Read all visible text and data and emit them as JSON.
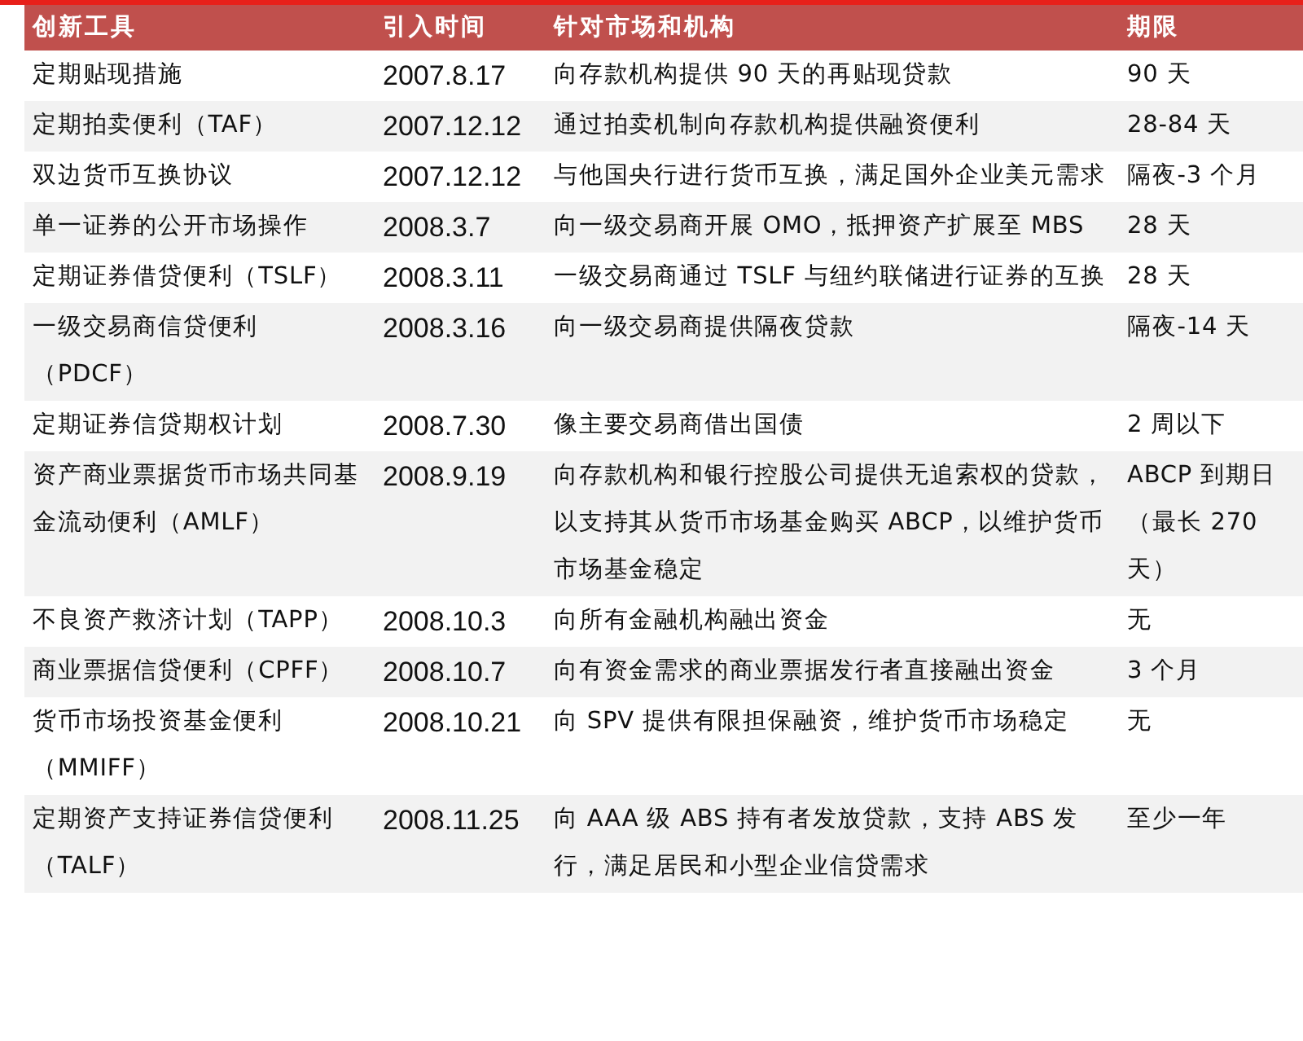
{
  "table": {
    "columns": [
      "创新工具",
      "引入时间",
      "针对市场和机构",
      "期限"
    ],
    "rows": [
      [
        "定期贴现措施",
        "2007.8.17",
        "向存款机构提供 90 天的再贴现贷款",
        "90 天"
      ],
      [
        "定期拍卖便利（TAF）",
        "2007.12.12",
        "通过拍卖机制向存款机构提供融资便利",
        "28-84 天"
      ],
      [
        "双边货币互换协议",
        "2007.12.12",
        "与他国央行进行货币互换，满足国外企业美元需求",
        "隔夜-3 个月"
      ],
      [
        "单一证券的公开市场操作",
        "2008.3.7",
        "向一级交易商开展 OMO，抵押资产扩展至 MBS",
        "28 天"
      ],
      [
        "定期证券借贷便利（TSLF）",
        "2008.3.11",
        "一级交易商通过 TSLF 与纽约联储进行证券的互换",
        "28 天"
      ],
      [
        "一级交易商信贷便利（PDCF）",
        "2008.3.16",
        "向一级交易商提供隔夜贷款",
        "隔夜-14 天"
      ],
      [
        "定期证券信贷期权计划",
        "2008.7.30",
        "像主要交易商借出国债",
        "2 周以下"
      ],
      [
        "资产商业票据货币市场共同基金流动便利（AMLF）",
        "2008.9.19",
        "向存款机构和银行控股公司提供无追索权的贷款，以支持其从货币市场基金购买 ABCP，以维护货币市场基金稳定",
        "ABCP 到期日（最长 270 天）"
      ],
      [
        "不良资产救济计划（TAPP）",
        "2008.10.3",
        "向所有金融机构融出资金",
        "无"
      ],
      [
        "商业票据信贷便利（CPFF）",
        "2008.10.7",
        "向有资金需求的商业票据发行者直接融出资金",
        "3 个月"
      ],
      [
        "货币市场投资基金便利（MMIFF）",
        "2008.10.21",
        "向 SPV 提供有限担保融资，维护货币市场稳定",
        "无"
      ],
      [
        "定期资产支持证券信贷便利（TALF）",
        "2008.11.25",
        "向 AAA 级 ABS 持有者发放贷款，支持 ABS 发行，满足居民和小型企业信贷需求",
        "至少一年"
      ]
    ]
  }
}
